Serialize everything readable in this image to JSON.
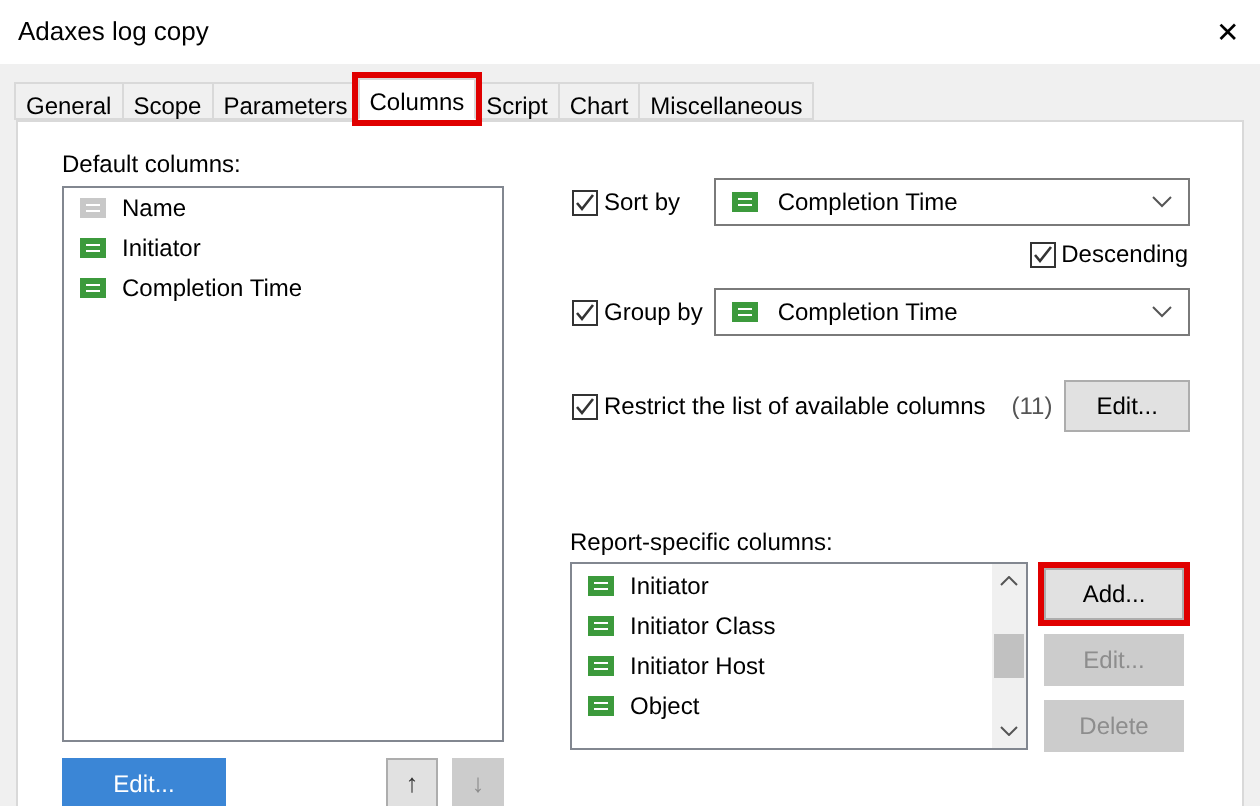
{
  "window": {
    "title": "Adaxes log copy",
    "close": "✕"
  },
  "tabs": [
    {
      "label": "General",
      "selected": false,
      "highlighted": false
    },
    {
      "label": "Scope",
      "selected": false,
      "highlighted": false
    },
    {
      "label": "Parameters",
      "selected": false,
      "highlighted": false
    },
    {
      "label": "Columns",
      "selected": true,
      "highlighted": true
    },
    {
      "label": "Script",
      "selected": false,
      "highlighted": false
    },
    {
      "label": "Chart",
      "selected": false,
      "highlighted": false
    },
    {
      "label": "Miscellaneous",
      "selected": false,
      "highlighted": false
    }
  ],
  "default_columns": {
    "label": "Default columns:",
    "items": [
      {
        "name": "Name",
        "color": "#c8c8c8"
      },
      {
        "name": "Initiator",
        "color": "#3c9a3c"
      },
      {
        "name": "Completion Time",
        "color": "#3c9a3c"
      }
    ],
    "edit_button": {
      "label": "Edit...",
      "focused": true
    },
    "up_button": {
      "label": "↑",
      "disabled": false
    },
    "down_button": {
      "label": "↓",
      "disabled": true
    }
  },
  "sort_by": {
    "label": "Sort by",
    "checked": true,
    "value": "Completion Time"
  },
  "descending": {
    "label": "Descending",
    "checked": true
  },
  "group_by": {
    "label": "Group by",
    "checked": true,
    "value": "Completion Time"
  },
  "restrict": {
    "label": "Restrict the list of available columns",
    "checked": true,
    "count": "(11)",
    "button": "Edit..."
  },
  "report_columns": {
    "label": "Report-specific columns:",
    "items": [
      "Initiator",
      "Initiator Class",
      "Initiator Host",
      "Object"
    ],
    "buttons": [
      {
        "label": "Add...",
        "disabled": false,
        "highlighted": true
      },
      {
        "label": "Edit...",
        "disabled": true,
        "highlighted": false
      },
      {
        "label": "Delete",
        "disabled": true,
        "highlighted": false
      }
    ]
  }
}
